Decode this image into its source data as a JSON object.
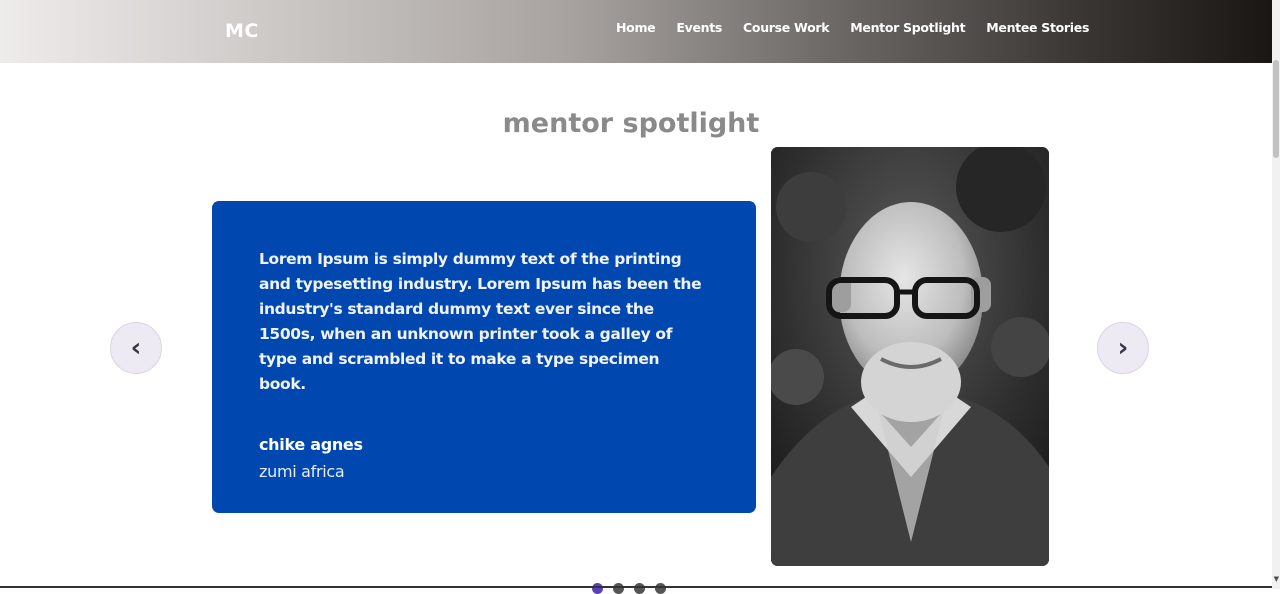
{
  "navbar": {
    "brand": "MC",
    "links": [
      "Home",
      "Events",
      "Course Work",
      "Mentor Spotlight",
      "Mentee Stories"
    ]
  },
  "section": {
    "title": "mentor spotlight"
  },
  "slide": {
    "quote": "Lorem Ipsum is simply dummy text of the printing and typesetting industry. Lorem Ipsum has been the industry's standard dummy text ever since the 1500s, when an unknown printer took a galley of type and scrambled it to make a type specimen book.",
    "name": "chike agnes",
    "organization": "zumi africa"
  },
  "carousel": {
    "prev_icon": "‹",
    "next_icon": "›",
    "slide_count": 4,
    "active_index": 0
  },
  "colors": {
    "card_bg": "#0048b0",
    "title": "#8a8a8a",
    "active_dot": "#5b3fb8"
  }
}
